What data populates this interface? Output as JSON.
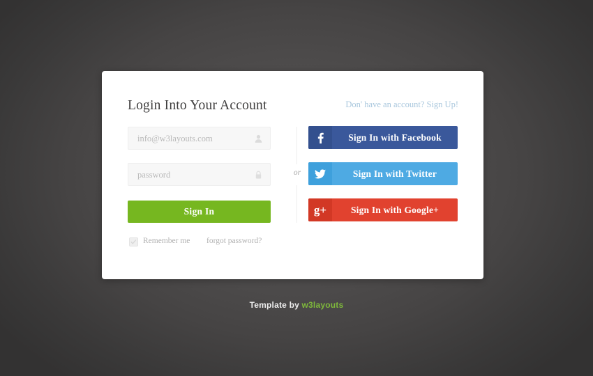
{
  "theme": {
    "background_dark": "#3a3939",
    "background_light": "#565353",
    "card_background": "#ffffff",
    "accent_green": "#76b720",
    "facebook_blue": "#3a589b",
    "twitter_blue": "#4eaae3",
    "google_red": "#e1422f",
    "link_blue": "#a9c7dd",
    "muted_text": "#b1b1b1",
    "brand_green": "#7eb83b"
  },
  "login_card": {
    "title": "Login Into Your Account",
    "signup_link": "Don' have an account? Sign Up!",
    "fields": {
      "email": {
        "value": "info@w3layouts.com",
        "placeholder": "info@w3layouts.com",
        "icon": "user-icon"
      },
      "password": {
        "value": "",
        "placeholder": "password",
        "icon": "lock-icon"
      }
    },
    "submit_label": "Sign In",
    "remember_me": {
      "label": "Remember me",
      "checked": true,
      "icon": "check-icon"
    },
    "forgot_password_label": "forgot password?",
    "divider_label": "or",
    "social_buttons": [
      {
        "label": "Sign In with Facebook",
        "icon": "facebook-icon",
        "glyph": "f",
        "color": "#3a589b"
      },
      {
        "label": "Sign In with Twitter",
        "icon": "twitter-icon",
        "glyph": "",
        "color": "#4eaae3"
      },
      {
        "label": "Sign In with Google+",
        "icon": "google-plus-icon",
        "glyph": "g+",
        "color": "#e1422f"
      }
    ]
  },
  "footer": {
    "prefix": "Template by ",
    "brand": "w3layouts"
  }
}
